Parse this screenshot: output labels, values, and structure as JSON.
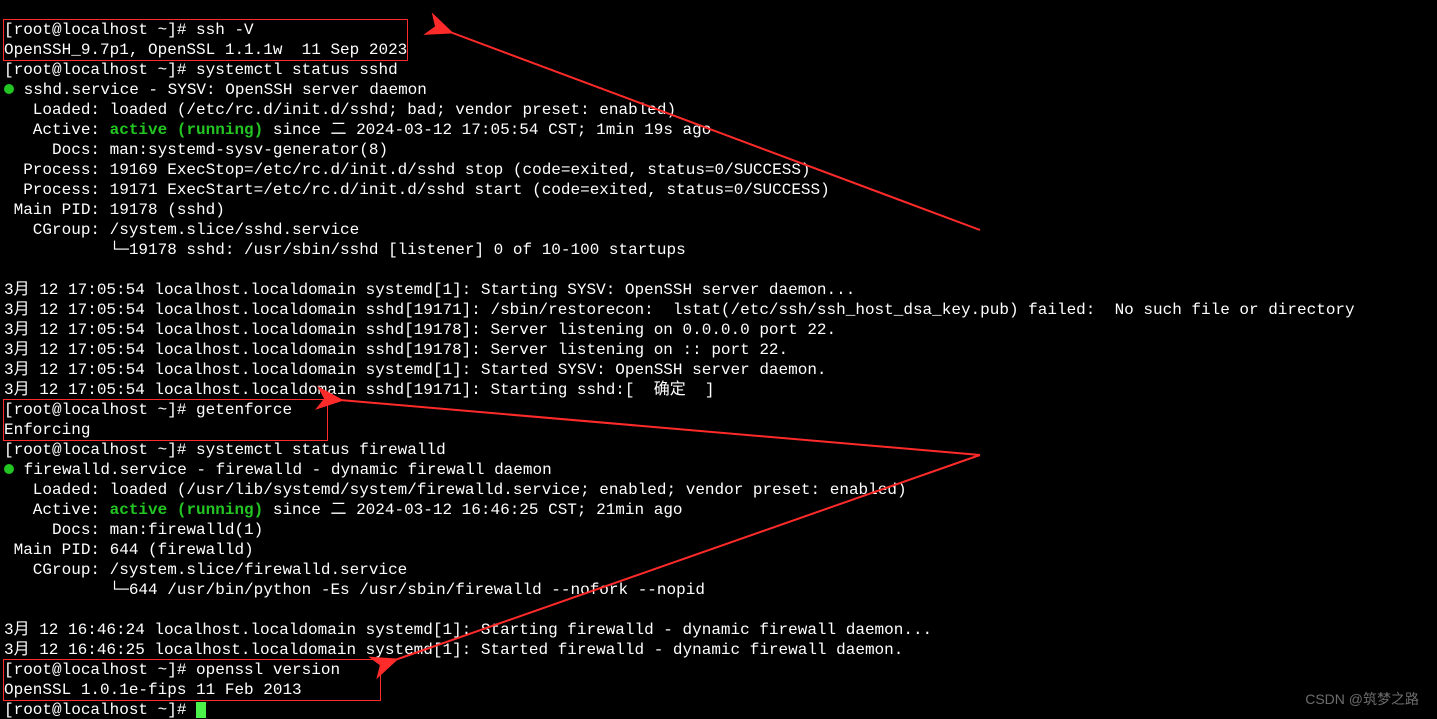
{
  "prompt": "[root@localhost ~]# ",
  "cmd": {
    "ssh_v": "ssh -V",
    "ssh_v_out": "OpenSSH_9.7p1, OpenSSL 1.1.1w  11 Sep 2023",
    "status_sshd": "systemctl status sshd",
    "getenforce": "getenforce",
    "getenforce_out": "Enforcing",
    "status_firewalld": "systemctl status firewalld",
    "openssl_ver": "openssl version",
    "openssl_ver_out": "OpenSSL 1.0.1e-fips 11 Feb 2013"
  },
  "sshd": {
    "title": " sshd.service - SYSV: OpenSSH server daemon",
    "loaded": "   Loaded: loaded (/etc/rc.d/init.d/sshd; bad; vendor preset: enabled)",
    "active_pre": "   Active: ",
    "active_state": "active (running)",
    "active_suf": " since 二 2024-03-12 17:05:54 CST; 1min 19s ago",
    "docs": "     Docs: man:systemd-sysv-generator(8)",
    "proc1": "  Process: 19169 ExecStop=/etc/rc.d/init.d/sshd stop (code=exited, status=0/SUCCESS)",
    "proc2": "  Process: 19171 ExecStart=/etc/rc.d/init.d/sshd start (code=exited, status=0/SUCCESS)",
    "mainpid": " Main PID: 19178 (sshd)",
    "cgroup": "   CGroup: /system.slice/sshd.service",
    "cgroup2": "           └─19178 sshd: /usr/sbin/sshd [listener] 0 of 10-100 startups",
    "log1": "3月 12 17:05:54 localhost.localdomain systemd[1]: Starting SYSV: OpenSSH server daemon...",
    "log2": "3月 12 17:05:54 localhost.localdomain sshd[19171]: /sbin/restorecon:  lstat(/etc/ssh/ssh_host_dsa_key.pub) failed:  No such file or directory",
    "log3": "3月 12 17:05:54 localhost.localdomain sshd[19178]: Server listening on 0.0.0.0 port 22.",
    "log4": "3月 12 17:05:54 localhost.localdomain sshd[19178]: Server listening on :: port 22.",
    "log5": "3月 12 17:05:54 localhost.localdomain systemd[1]: Started SYSV: OpenSSH server daemon.",
    "log6": "3月 12 17:05:54 localhost.localdomain sshd[19171]: Starting sshd:[  确定  ]"
  },
  "fw": {
    "title": " firewalld.service - firewalld - dynamic firewall daemon",
    "loaded": "   Loaded: loaded (/usr/lib/systemd/system/firewalld.service; enabled; vendor preset: enabled)",
    "active_pre": "   Active: ",
    "active_state": "active (running)",
    "active_suf": " since 二 2024-03-12 16:46:25 CST; 21min ago",
    "docs": "     Docs: man:firewalld(1)",
    "mainpid": " Main PID: 644 (firewalld)",
    "cgroup": "   CGroup: /system.slice/firewalld.service",
    "cgroup2": "           └─644 /usr/bin/python -Es /usr/sbin/firewalld --nofork --nopid",
    "log1": "3月 12 16:46:24 localhost.localdomain systemd[1]: Starting firewalld - dynamic firewall daemon...",
    "log2": "3月 12 16:46:25 localhost.localdomain systemd[1]: Started firewalld - dynamic firewall daemon."
  },
  "watermark": "CSDN @筑梦之路"
}
